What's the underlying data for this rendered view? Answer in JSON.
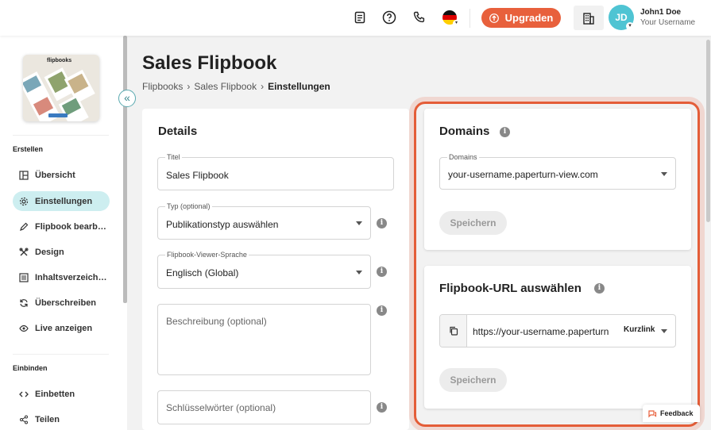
{
  "topbar": {
    "upgrade_label": "Upgraden",
    "user": {
      "initials": "JD",
      "name": "John1 Doe",
      "subtitle": "Your Username"
    },
    "icons": [
      "document-icon",
      "help-icon",
      "phone-icon",
      "flag-de-icon",
      "building-icon"
    ],
    "accent_color": "#e8603c"
  },
  "sidebar": {
    "sections": [
      {
        "heading": "Erstellen",
        "items": [
          {
            "label": "Übersicht",
            "icon": "layout-icon",
            "active": false
          },
          {
            "label": "Einstellungen",
            "icon": "gear-icon",
            "active": true
          },
          {
            "label": "Flipbook bearb…",
            "icon": "pencil-icon",
            "active": false
          },
          {
            "label": "Design",
            "icon": "tools-icon",
            "active": false
          },
          {
            "label": "Inhaltsverzeich…",
            "icon": "list-icon",
            "active": false
          },
          {
            "label": "Überschreiben",
            "icon": "refresh-icon",
            "active": false
          },
          {
            "label": "Live anzeigen",
            "icon": "eye-icon",
            "active": false
          }
        ]
      },
      {
        "heading": "Einbinden",
        "items": [
          {
            "label": "Einbetten",
            "icon": "code-icon",
            "active": false
          },
          {
            "label": "Teilen",
            "icon": "share-icon",
            "active": false
          }
        ]
      }
    ],
    "thumbnail_text": "flipbooks",
    "active_color": "#cdeef0"
  },
  "page": {
    "title": "Sales Flipbook",
    "breadcrumb": [
      "Flipbooks",
      "Sales Flipbook",
      "Einstellungen"
    ]
  },
  "details": {
    "heading": "Details",
    "title_field": {
      "label": "Titel",
      "value": "Sales Flipbook"
    },
    "type_field": {
      "label": "Typ (optional)",
      "value": "Publikationstyp auswählen"
    },
    "language_field": {
      "label": "Flipbook-Viewer-Sprache",
      "value": "Englisch (Global)"
    },
    "description_field": {
      "placeholder": "Beschreibung (optional)"
    },
    "keywords_field": {
      "placeholder": "Schlüsselwörter (optional)"
    }
  },
  "domains": {
    "heading": "Domains",
    "select_label": "Domains",
    "select_value": "your-username.paperturn-view.com",
    "save_label": "Speichern"
  },
  "url": {
    "heading": "Flipbook-URL auswählen",
    "value": "https://your-username.paperturn",
    "mode": "Kurzlink",
    "save_label": "Speichern"
  },
  "feedback_label": "Feedback"
}
